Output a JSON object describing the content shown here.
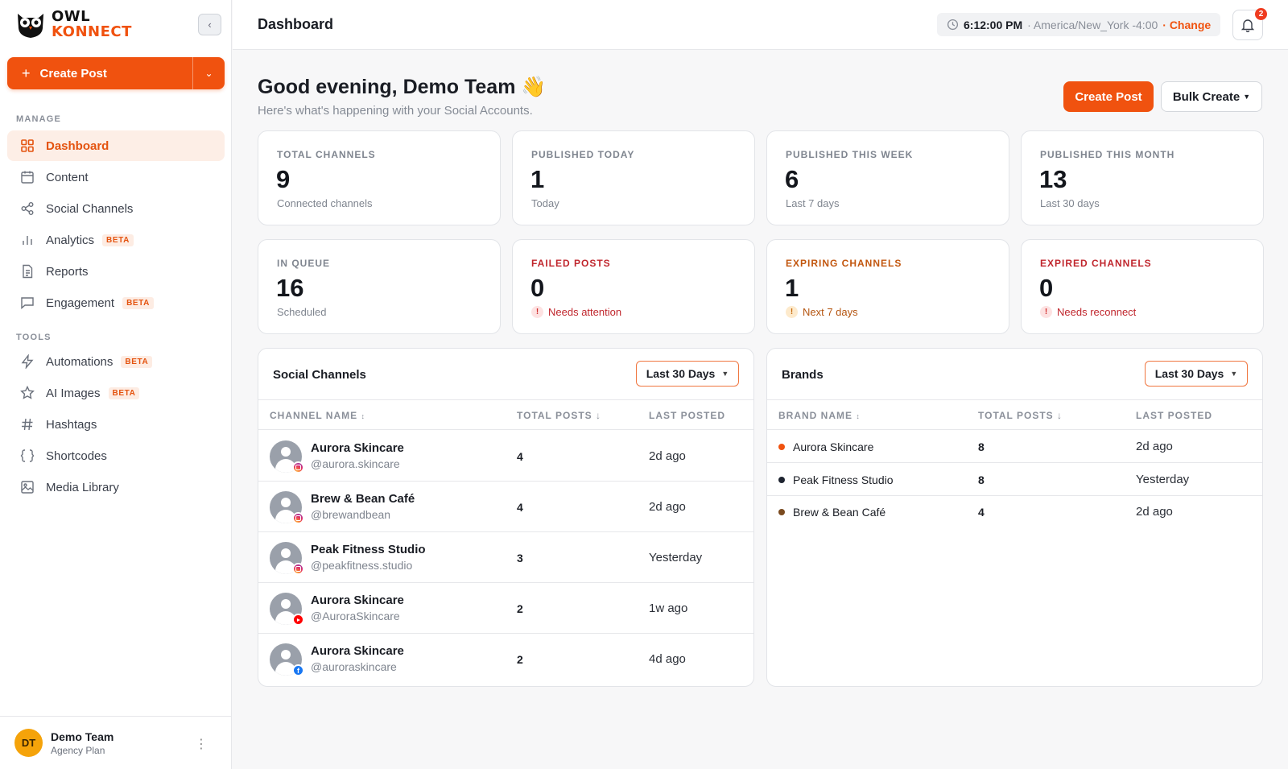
{
  "app": {
    "logo_line1": "OWL",
    "logo_line2": "KONNECT"
  },
  "sidebar": {
    "create_post_label": "Create Post",
    "manage_label": "MANAGE",
    "tools_label": "TOOLS",
    "manage_items": [
      {
        "label": "Dashboard",
        "icon": "grid-icon",
        "active": true
      },
      {
        "label": "Content",
        "icon": "calendar-icon"
      },
      {
        "label": "Social Channels",
        "icon": "share-icon"
      },
      {
        "label": "Analytics",
        "icon": "bar-chart-icon",
        "badge": "BETA"
      },
      {
        "label": "Reports",
        "icon": "document-icon"
      },
      {
        "label": "Engagement",
        "icon": "chat-icon",
        "badge": "BETA"
      }
    ],
    "tools_items": [
      {
        "label": "Automations",
        "icon": "bolt-icon",
        "badge": "BETA"
      },
      {
        "label": "AI Images",
        "icon": "sparkle-icon",
        "badge": "BETA"
      },
      {
        "label": "Hashtags",
        "icon": "hash-icon"
      },
      {
        "label": "Shortcodes",
        "icon": "braces-icon"
      },
      {
        "label": "Media Library",
        "icon": "image-icon"
      }
    ],
    "user": {
      "initials": "DT",
      "name": "Demo Team",
      "plan": "Agency Plan"
    }
  },
  "topbar": {
    "title": "Dashboard",
    "time": "6:12:00 PM",
    "timezone": "· America/New_York -4:00",
    "change_label": "· Change",
    "notification_count": "2"
  },
  "header": {
    "greeting": "Good evening, Demo Team 👋",
    "subtitle": "Here's what's happening with your Social Accounts.",
    "create_post_label": "Create Post",
    "bulk_create_label": "Bulk Create"
  },
  "stats": [
    {
      "label": "TOTAL CHANNELS",
      "value": "9",
      "sub": "Connected channels"
    },
    {
      "label": "PUBLISHED TODAY",
      "value": "1",
      "sub": "Today"
    },
    {
      "label": "PUBLISHED THIS WEEK",
      "value": "6",
      "sub": "Last 7 days"
    },
    {
      "label": "PUBLISHED THIS MONTH",
      "value": "13",
      "sub": "Last 30 days"
    },
    {
      "label": "IN QUEUE",
      "value": "16",
      "sub": "Scheduled"
    },
    {
      "label": "FAILED POSTS",
      "value": "0",
      "sub": "Needs attention"
    },
    {
      "label": "EXPIRING CHANNELS",
      "value": "1",
      "sub": "Next 7 days"
    },
    {
      "label": "EXPIRED CHANNELS",
      "value": "0",
      "sub": "Needs reconnect"
    }
  ],
  "social_channels": {
    "title": "Social Channels",
    "range": "Last 30 Days",
    "columns": [
      "CHANNEL NAME",
      "TOTAL POSTS",
      "LAST POSTED"
    ],
    "rows": [
      {
        "name": "Aurora Skincare",
        "handle": "@aurora.skincare",
        "platform": "instagram",
        "posts": "4",
        "last": "2d ago"
      },
      {
        "name": "Brew & Bean Café",
        "handle": "@brewandbean",
        "platform": "instagram",
        "posts": "4",
        "last": "2d ago"
      },
      {
        "name": "Peak Fitness Studio",
        "handle": "@peakfitness.studio",
        "platform": "instagram",
        "posts": "3",
        "last": "Yesterday"
      },
      {
        "name": "Aurora Skincare",
        "handle": "@AuroraSkincare",
        "platform": "youtube",
        "posts": "2",
        "last": "1w ago"
      },
      {
        "name": "Aurora Skincare",
        "handle": "@auroraskincare",
        "platform": "facebook",
        "posts": "2",
        "last": "4d ago"
      }
    ]
  },
  "brands": {
    "title": "Brands",
    "range": "Last 30 Days",
    "columns": [
      "BRAND NAME",
      "TOTAL POSTS",
      "LAST POSTED"
    ],
    "rows": [
      {
        "name": "Aurora Skincare",
        "color": "#f0520f",
        "posts": "8",
        "last": "2d ago"
      },
      {
        "name": "Peak Fitness Studio",
        "color": "#1e2430",
        "posts": "8",
        "last": "Yesterday"
      },
      {
        "name": "Brew & Bean Café",
        "color": "#7a4a1f",
        "posts": "4",
        "last": "2d ago"
      }
    ]
  }
}
